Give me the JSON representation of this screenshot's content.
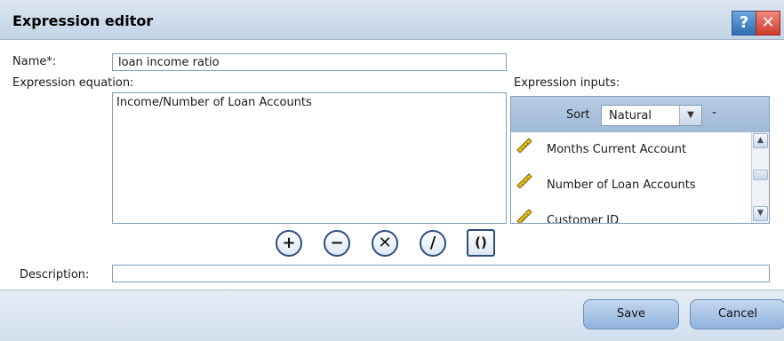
{
  "window": {
    "title": "Expression editor",
    "help_label": "?",
    "close_label": "✕"
  },
  "form": {
    "name_label": "Name*:",
    "name_value": "loan income ratio",
    "equation_label": "Expression equation:",
    "equation_value": "Income/Number of Loan Accounts",
    "inputs_label": "Expression inputs:",
    "description_label": "Description:",
    "description_value": ""
  },
  "inputs": {
    "sort_label": "Sort",
    "sort_value": "Natural",
    "sort_extra": "-",
    "items": [
      {
        "label": "Months Current Account",
        "icon": "ruler-icon"
      },
      {
        "label": "Number of Loan Accounts",
        "icon": "ruler-icon"
      },
      {
        "label": "Customer ID",
        "icon": "ruler-icon"
      }
    ]
  },
  "operators": {
    "plus": "+",
    "minus": "−",
    "multiply": "✕",
    "divide": "/",
    "parens": "()"
  },
  "buttons": {
    "save": "Save",
    "cancel": "Cancel"
  },
  "colors": {
    "accent": "#2b4d7a",
    "titlebar": "#c3d3e5",
    "button": "#8fb2dc"
  }
}
